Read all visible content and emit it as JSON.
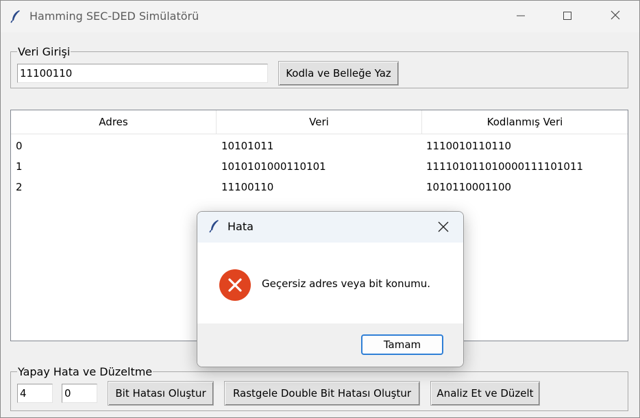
{
  "window": {
    "title": "Hamming SEC-DED Simülatörü"
  },
  "input_frame": {
    "legend": "Veri Girişi",
    "data_value": "11100110",
    "encode_button": "Kodla ve Belleğe Yaz"
  },
  "memory_table": {
    "columns": [
      "Adres",
      "Veri",
      "Kodlanmış Veri"
    ],
    "rows": [
      [
        "0",
        "10101011",
        "1110010110110"
      ],
      [
        "1",
        "1010101000110101",
        "111101011010000111101011"
      ],
      [
        "2",
        "11100110",
        "1010110001100"
      ]
    ]
  },
  "error_frame": {
    "legend": "Yapay Hata ve Düzeltme",
    "address_value": "4",
    "bit_value": "0",
    "bit_error_button": "Bit Hatası Oluştur",
    "double_bit_button": "Rastgele Double Bit Hatası Oluştur",
    "analyze_button": "Analiz Et ve Düzelt"
  },
  "dialog": {
    "title": "Hata",
    "message": "Geçersiz adres veya bit konumu.",
    "ok_button": "Tamam",
    "error_color": "#e0441f"
  }
}
